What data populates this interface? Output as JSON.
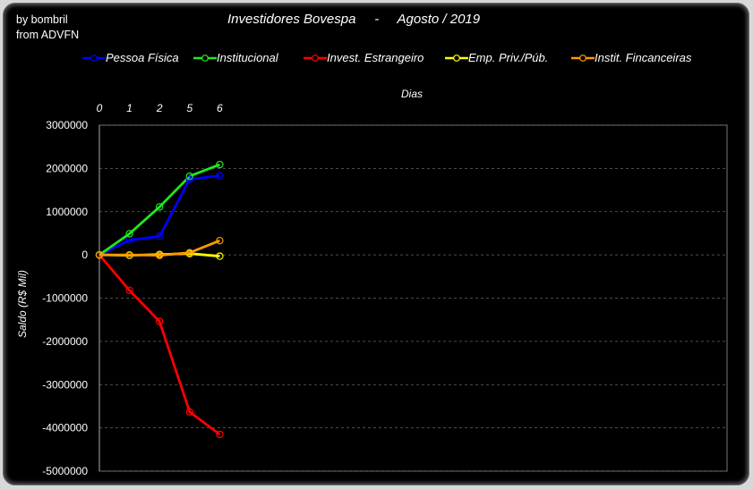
{
  "credit": {
    "line1": "by bombril",
    "line2": "from ADVFN"
  },
  "chart_data": {
    "type": "line",
    "title": "Investidores Bovespa     -     Agosto / 2019",
    "xlabel": "Dias",
    "ylabel": "Saldo (R$ Mil)",
    "x": [
      "0",
      "1",
      "2",
      "5",
      "6"
    ],
    "ylim": [
      -5000000,
      3000000
    ],
    "yticks": [
      "3000000",
      "2000000",
      "1000000",
      "0",
      "-1000000",
      "-2000000",
      "-3000000",
      "-4000000",
      "-5000000"
    ],
    "grid": true,
    "legend_position": "top",
    "series": [
      {
        "name": "Pessoa Física",
        "color": "#0000ff",
        "values": [
          0,
          340000,
          430000,
          1750000,
          1830000
        ]
      },
      {
        "name": "Institucional",
        "color": "#22e622",
        "values": [
          0,
          490000,
          1110000,
          1820000,
          2090000
        ]
      },
      {
        "name": "Invest. Estrangeiro",
        "color": "#ff0000",
        "values": [
          0,
          -820000,
          -1540000,
          -3630000,
          -4150000
        ]
      },
      {
        "name": "Emp. Priv./Púb.",
        "color": "#ffff00",
        "values": [
          0,
          -10000,
          10000,
          30000,
          -30000
        ]
      },
      {
        "name": "Instit. Fincanceiras",
        "color": "#ff9900",
        "values": [
          0,
          0,
          -10000,
          50000,
          330000
        ]
      }
    ]
  }
}
